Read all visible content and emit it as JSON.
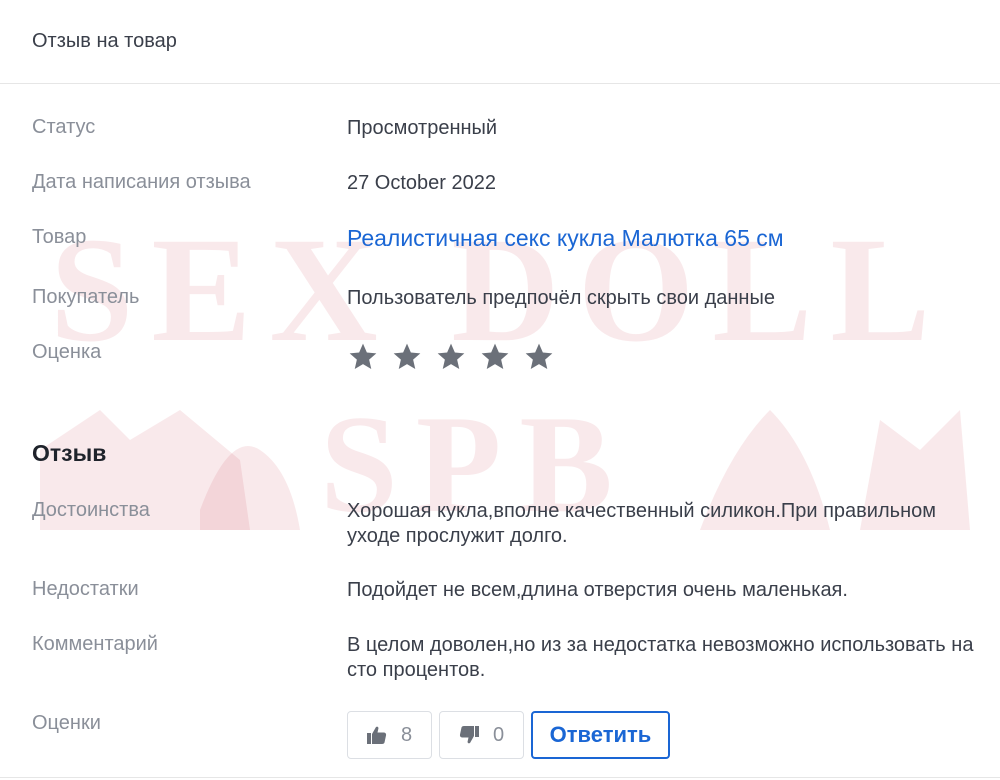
{
  "header": {
    "title": "Отзыв на товар"
  },
  "details": {
    "status": {
      "label": "Статус",
      "value": "Просмотренный"
    },
    "date": {
      "label": "Дата написания отзыва",
      "value": "27 October 2022"
    },
    "product": {
      "label": "Товар",
      "value": "Реалистичная секс кукла Малютка 65 см"
    },
    "buyer": {
      "label": "Покупатель",
      "value": "Пользователь предпочёл скрыть свои данные"
    },
    "rating": {
      "label": "Оценка",
      "stars": 5,
      "star_color": "#6b7079"
    }
  },
  "review": {
    "title": "Отзыв",
    "pros": {
      "label": "Достоинства",
      "value": "Хорошая кукла,вполне качественный силикон.При правильном уходе прослужит долго."
    },
    "cons": {
      "label": "Недостатки",
      "value": "Подойдет не всем,длина отверстия очень маленькая."
    },
    "comment": {
      "label": "Комментарий",
      "value": "В целом доволен,но из за недостатка невозможно использовать на сто процентов."
    },
    "votes": {
      "label": "Оценки",
      "likes": "8",
      "dislikes": "0",
      "reply_label": "Ответить"
    }
  },
  "watermark": {
    "line1": "SEX DOLL",
    "line2": "SPB",
    "color": "#c8283c"
  },
  "colors": {
    "link": "#1a66d4",
    "label": "#8a8f99",
    "text": "#3a3f4a"
  }
}
